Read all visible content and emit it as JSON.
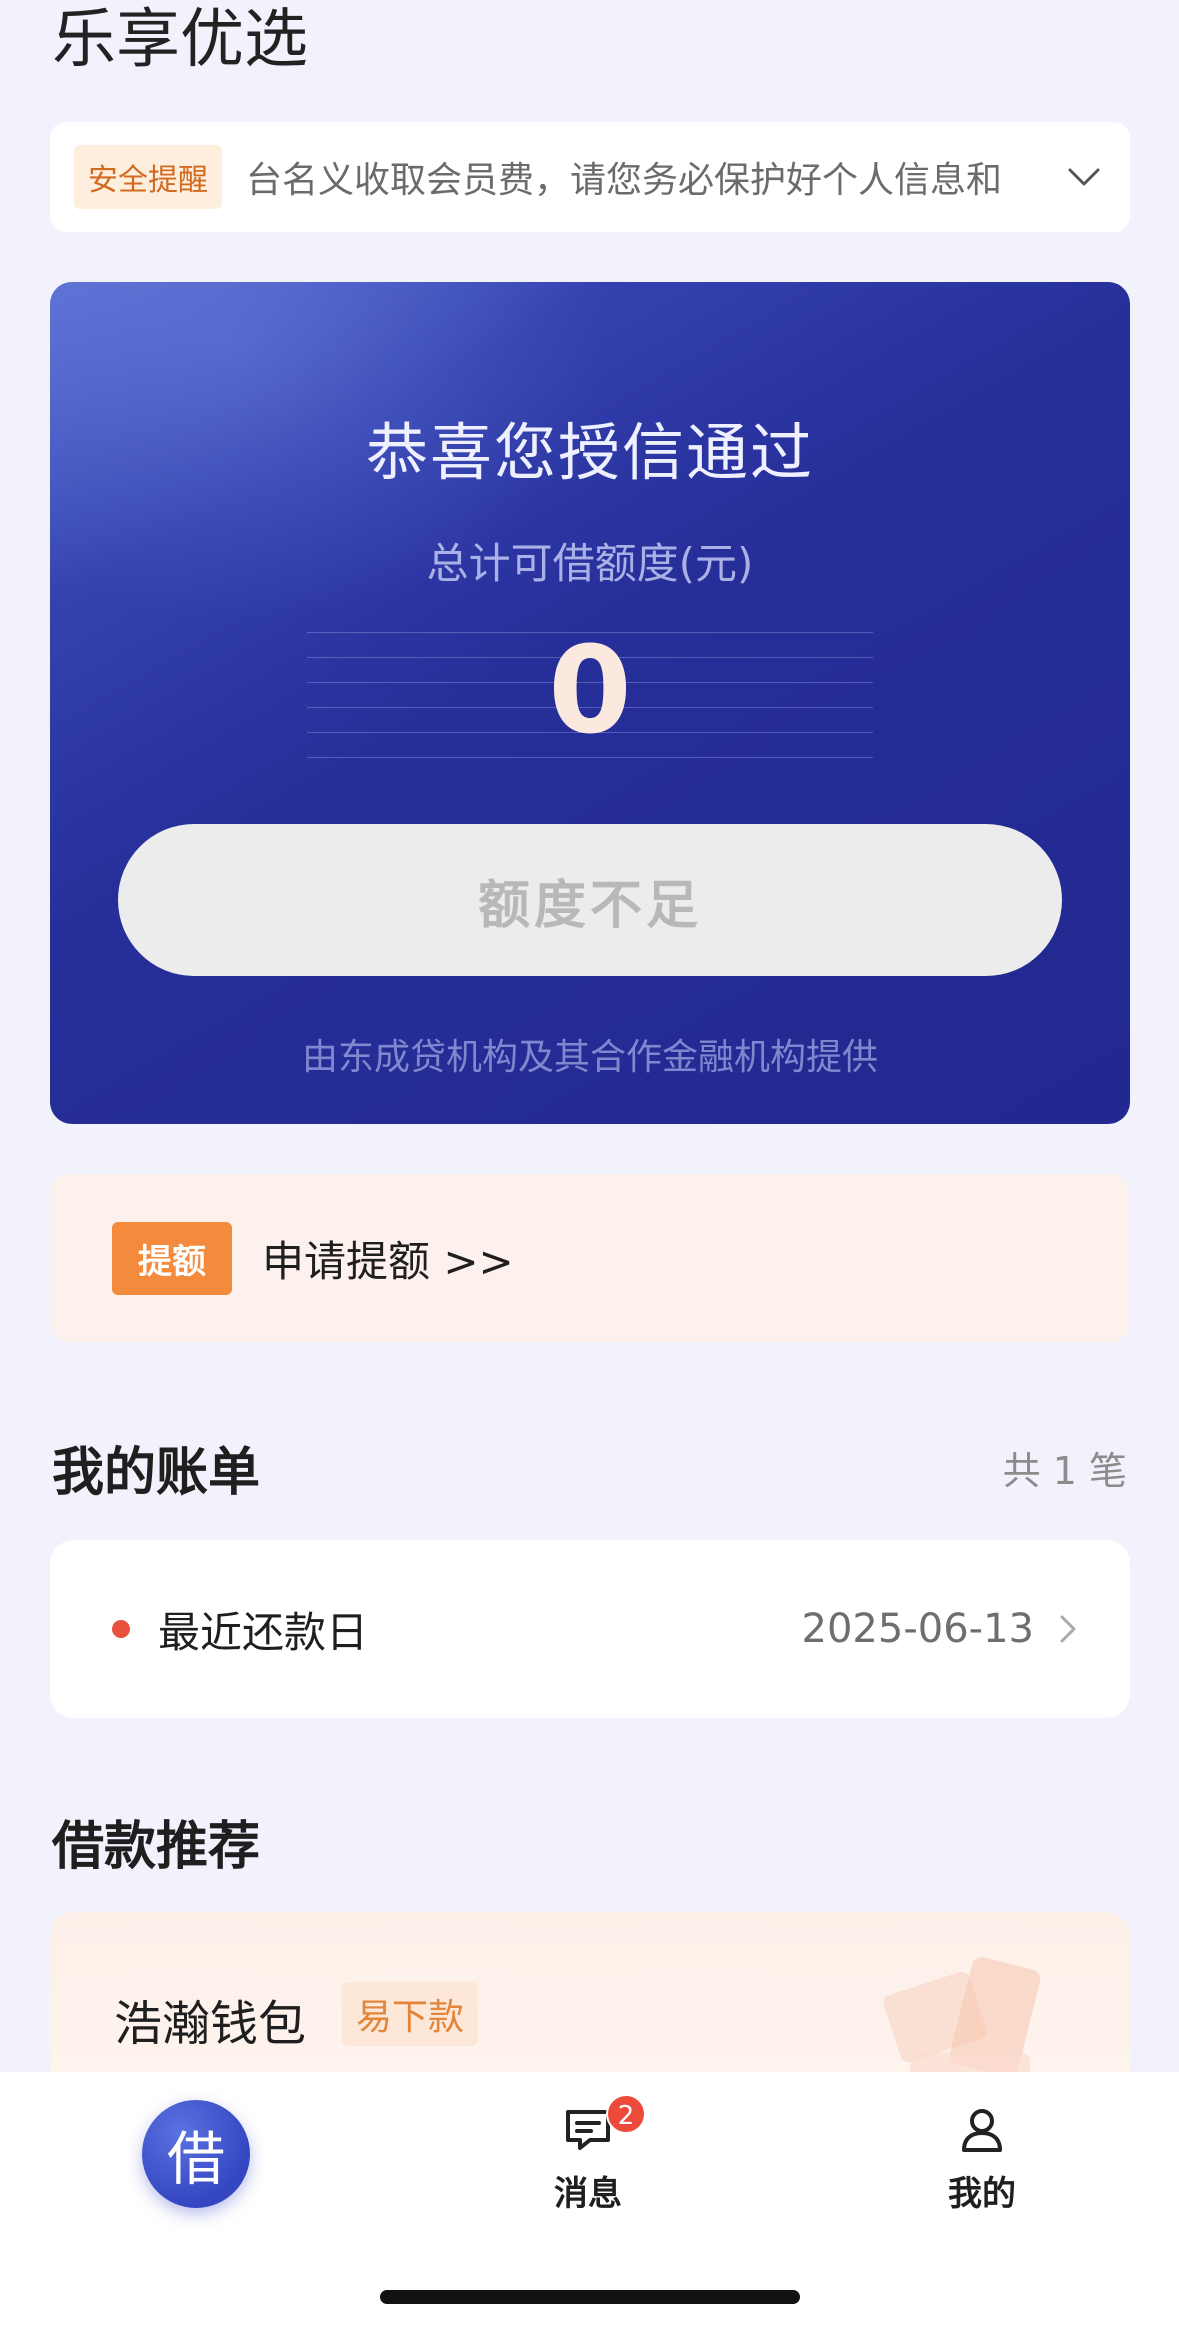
{
  "app": {
    "title": "乐享优选"
  },
  "notice": {
    "tag": "安全提醒",
    "text": "台名义收取会员费，请您务必保护好个人信息和"
  },
  "credit": {
    "title": "恭喜您授信通过",
    "subtitle": "总计可借额度(元)",
    "amount": "0",
    "button_label": "额度不足",
    "provider": "由东成贷机构及其合作金融机构提供"
  },
  "raise": {
    "tag": "提额",
    "text": "申请提额 >>"
  },
  "bills": {
    "heading": "我的账单",
    "count_text": "共 1 笔",
    "items": [
      {
        "label": "最近还款日",
        "date": "2025-06-13"
      }
    ]
  },
  "recommendations": {
    "heading": "借款推荐",
    "items": [
      {
        "name": "浩瀚钱包",
        "tag": "易下款"
      }
    ]
  },
  "tabs": {
    "borrow": {
      "label": "借"
    },
    "messages": {
      "label": "消息",
      "badge": "2"
    },
    "mine": {
      "label": "我的"
    }
  },
  "colors": {
    "card_blue": "#262e99",
    "accent_orange": "#f38a3c",
    "alert_red": "#ee4a3b"
  }
}
